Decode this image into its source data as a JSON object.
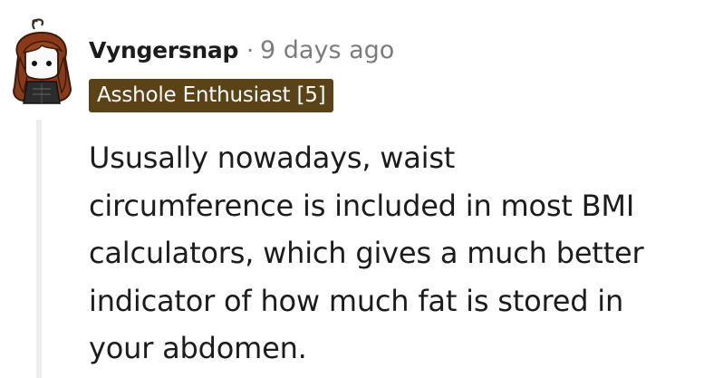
{
  "comment": {
    "username": "Vyngersnap",
    "separator": "·",
    "timestamp": "9 days ago",
    "flair": "Asshole Enthusiast [5]",
    "body": "Ususally nowadays, waist circumference is included in most BMI calculators, which gives a much better indicator of how much fat is stored in your abdomen.",
    "avatar_icon": "user-avatar-icon",
    "colors": {
      "flair_background": "#5b4217",
      "flair_text": "#ffffff",
      "username": "#1c1c1c",
      "meta": "#7c7c7c",
      "thread_line": "#ededed"
    }
  }
}
